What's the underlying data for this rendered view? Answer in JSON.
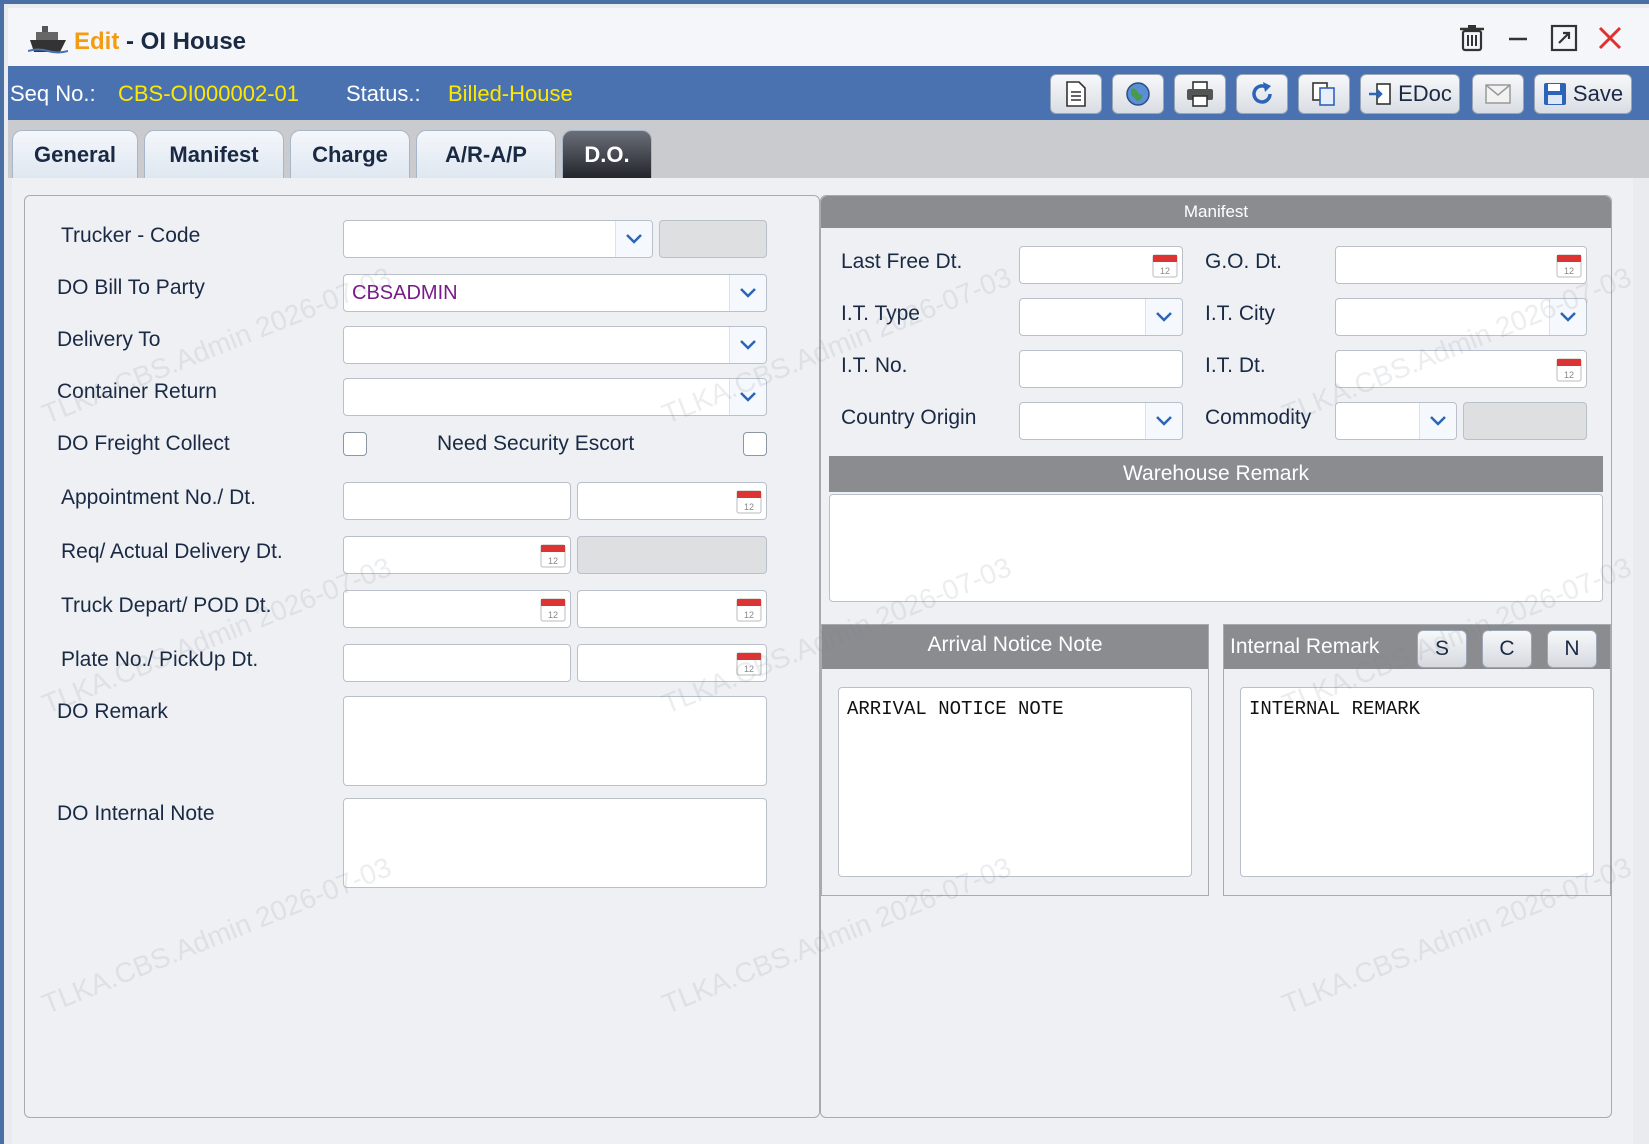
{
  "window": {
    "edit_label": "Edit",
    "separator": " - ",
    "title": "OI House",
    "controls": [
      "trash-icon",
      "minimize-icon",
      "maximize-icon",
      "close-icon"
    ]
  },
  "seq": {
    "seq_label": "Seq No.:",
    "seq_value": "CBS-OI000002-01",
    "status_label": "Status.:",
    "status_value": "Billed-House"
  },
  "toolbar": {
    "edoc_label": "EDoc",
    "save_label": "Save"
  },
  "tabs": [
    {
      "label": "General"
    },
    {
      "label": "Manifest"
    },
    {
      "label": "Charge"
    },
    {
      "label": "A/R-A/P"
    },
    {
      "label": "D.O."
    }
  ],
  "left": {
    "trucker_code_label": "Trucker - Code",
    "bill_to_label": "DO Bill To Party",
    "bill_to_value": "CBSADMIN",
    "delivery_to_label": "Delivery To",
    "container_return_label": "Container Return",
    "freight_collect_label": "DO Freight Collect",
    "security_escort_label": "Need Security Escort",
    "appointment_label": "Appointment No./ Dt.",
    "req_actual_label": "Req/ Actual Delivery Dt.",
    "truck_depart_label": "Truck Depart/ POD Dt.",
    "plate_label": "Plate No./ PickUp Dt.",
    "do_remark_label": "DO Remark",
    "do_internal_label": "DO Internal Note"
  },
  "right": {
    "manifest_header": "Manifest",
    "last_free_label": "Last Free Dt.",
    "go_dt_label": "G.O. Dt.",
    "it_type_label": "I.T. Type",
    "it_city_label": "I.T. City",
    "it_no_label": "I.T. No.",
    "it_dt_label": "I.T. Dt.",
    "country_origin_label": "Country Origin",
    "commodity_label": "Commodity",
    "warehouse_header": "Warehouse Remark",
    "arrival_header": "Arrival Notice Note",
    "arrival_text": "ARRIVAL NOTICE NOTE",
    "internal_header": "Internal Remark",
    "internal_text": "INTERNAL REMARK",
    "btn_s": "S",
    "btn_c": "C",
    "btn_n": "N"
  },
  "watermark": "TLKA.CBS.Admin 2026-07-03",
  "colors": {
    "accent": "#4a72b0",
    "status_yellow": "#ffe800",
    "edit_orange": "#f39c12",
    "close_red": "#e03030"
  }
}
